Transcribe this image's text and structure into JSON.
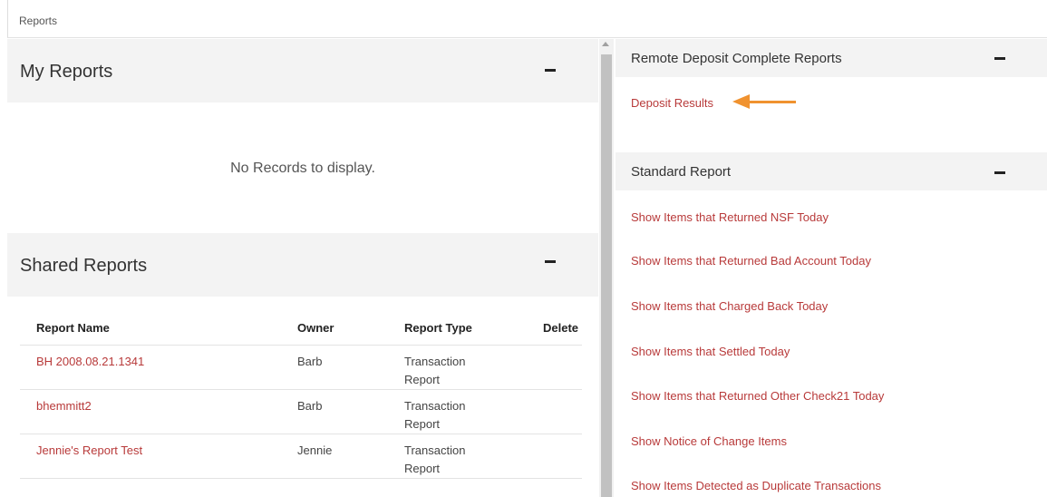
{
  "breadcrumb": "Reports",
  "my_reports": {
    "title": "My Reports",
    "empty_message": "No Records to display."
  },
  "shared_reports": {
    "title": "Shared Reports",
    "columns": [
      "Report Name",
      "Owner",
      "Report Type",
      "Delete"
    ],
    "rows": [
      {
        "name": "BH 2008.08.21.1341",
        "owner": "Barb",
        "type": "Transaction Report"
      },
      {
        "name": "bhemmitt2",
        "owner": "Barb",
        "type": "Transaction Report"
      },
      {
        "name": "Jennie's Report Test",
        "owner": "Jennie",
        "type": "Transaction Report"
      }
    ]
  },
  "remote_deposit": {
    "title": "Remote Deposit Complete Reports",
    "links": [
      "Deposit Results"
    ]
  },
  "standard_report": {
    "title": "Standard Report",
    "links": [
      "Show Items that Returned NSF Today",
      "Show Items that Returned Bad Account Today",
      "Show Items that Charged Back Today",
      "Show Items that Settled Today",
      "Show Items that Returned Other Check21 Today",
      "Show Notice of Change Items",
      "Show Items Detected as Duplicate Transactions"
    ]
  },
  "colors": {
    "link": "#b83a3a",
    "annotation_arrow": "#f0922f",
    "panel_header_bg": "#f3f3f3"
  },
  "icons": {
    "collapse": "minus-icon",
    "annotation": "arrow-left-icon"
  }
}
